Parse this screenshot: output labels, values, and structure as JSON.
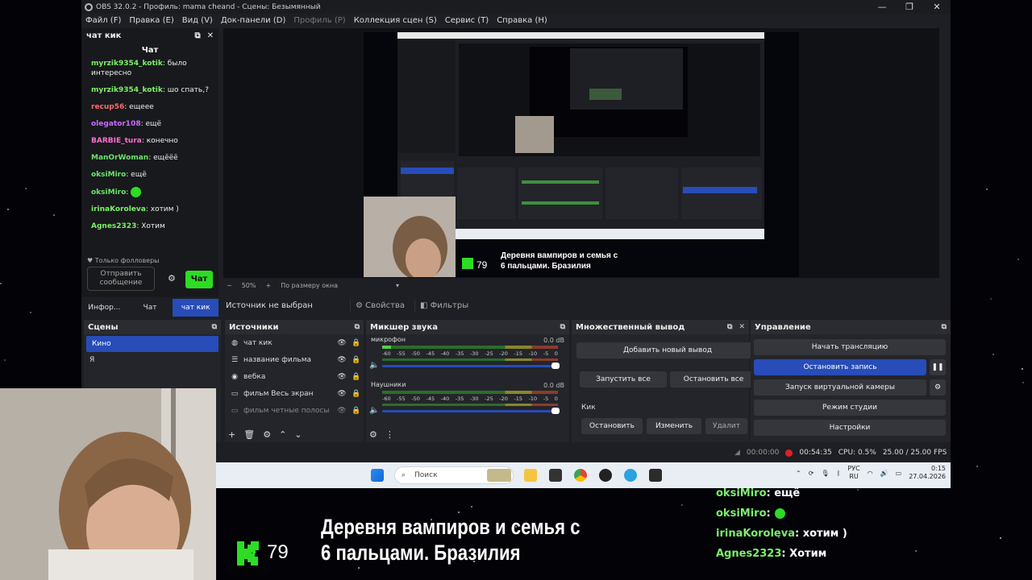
{
  "window": {
    "title": "OBS 32.0.2 - Профиль: mama cheand - Сцены: Безымянный",
    "min": "—",
    "max": "❐",
    "close": "✕"
  },
  "menu": [
    "Файл (F)",
    "Правка (E)",
    "Вид (V)",
    "Док-панели (D)",
    "Профиль (P)",
    "Коллекция сцен (S)",
    "Сервис (T)",
    "Справка (H)"
  ],
  "chat": {
    "dock_title": "чат кик",
    "panel_title": "Чат",
    "messages": [
      {
        "user": "myrzik9354_kotik",
        "text": ": было интересно",
        "color": "#7cf06a"
      },
      {
        "user": "myrzik9354_kotik",
        "text": ": шо спать,?",
        "color": "#7cf06a"
      },
      {
        "user": "recup56",
        "text": ": ещеее",
        "color": "#ff6b6b"
      },
      {
        "user": "olegator108",
        "text": ": ещё",
        "color": "#c96bff"
      },
      {
        "user": "BARBIE_tura",
        "text": ": конечно",
        "color": "#ff6fd1"
      },
      {
        "user": "ManOrWoman",
        "text": ": ещёёё",
        "color": "#6be36b"
      },
      {
        "user": "oksiMiro",
        "text": ": ещё",
        "color": "#6be36b"
      },
      {
        "user": "oksiMiro",
        "text": ":",
        "color": "#6be36b",
        "emote": true
      },
      {
        "user": "irinaKoroleva",
        "text": ": хотим )",
        "color": "#7cf06a"
      },
      {
        "user": "Agnes2323",
        "text": ": Хотим",
        "color": "#7cf06a"
      }
    ],
    "followers_only": "Только фолловеры",
    "input_placeholder": "Отправить сообщение",
    "send": "Чат"
  },
  "dock_tabs": [
    "Инфор...",
    "Чат",
    "чат кик"
  ],
  "preview": {
    "zoom": "50%",
    "fit": "По размеру окна"
  },
  "source_bar": {
    "no_source": "Источник не выбран",
    "properties": "Свойства",
    "filters": "Фильтры"
  },
  "scenes": {
    "title": "Сцены",
    "items": [
      "Кино",
      "Я"
    ]
  },
  "sources": {
    "title": "Источники",
    "items": [
      {
        "name": "чат кик",
        "icon": "browser-icon"
      },
      {
        "name": "название фильма",
        "icon": "text-icon"
      },
      {
        "name": "вебка",
        "icon": "camera-icon"
      },
      {
        "name": "фильм Весь экран",
        "icon": "display-icon"
      },
      {
        "name": "фильм четные полосы",
        "icon": "display-icon"
      }
    ]
  },
  "mixer": {
    "title": "Микшер звука",
    "ticks": [
      "-60",
      "-55",
      "-50",
      "-45",
      "-40",
      "-35",
      "-30",
      "-25",
      "-20",
      "-15",
      "-10",
      "-5",
      "0"
    ],
    "channels": [
      {
        "name": "микрофон",
        "db": "0.0 dB",
        "level": 0.05
      },
      {
        "name": "Наушники",
        "db": "0.0 dB",
        "level": 0.0
      }
    ]
  },
  "multistream": {
    "title": "Множественный вывод",
    "add": "Добавить новый вывод",
    "start_all": "Запустить все",
    "stop_all": "Остановить все",
    "target": "Кик",
    "stop": "Остановить",
    "edit": "Изменить",
    "delete": "Удалит"
  },
  "controls": {
    "title": "Управление",
    "start_stream": "Начать трансляцию",
    "stop_record": "Остановить запись",
    "virtual_cam": "Запуск виртуальной камеры",
    "studio": "Режим студии",
    "settings": "Настройки"
  },
  "status": {
    "stream_time": "00:00:00",
    "rec_time": "00:54:35",
    "cpu": "CPU: 0.5%",
    "fps": "25.00 / 25.00 FPS"
  },
  "taskbar": {
    "search": "Поиск",
    "lang": "РУС",
    "region": "RU",
    "time": "0:15",
    "date": "27.04.2026"
  },
  "overlay": {
    "kick_count": "79",
    "title_line1": "Деревня вампиров и семья с",
    "title_line2": "6 пальцами. Бразилия",
    "chat": [
      {
        "user": "oksiMiro",
        "text": ": ещё"
      },
      {
        "user": "oksiMiro",
        "text": ":",
        "emote": true
      },
      {
        "user": "irinaKoroleva",
        "text": ": хотим )"
      },
      {
        "user": "Agnes2323",
        "text": ": Хотим"
      }
    ]
  },
  "colors": {
    "accent": "#284cb8",
    "kick_green": "#2ddc23",
    "record_red": "#e0202a"
  }
}
